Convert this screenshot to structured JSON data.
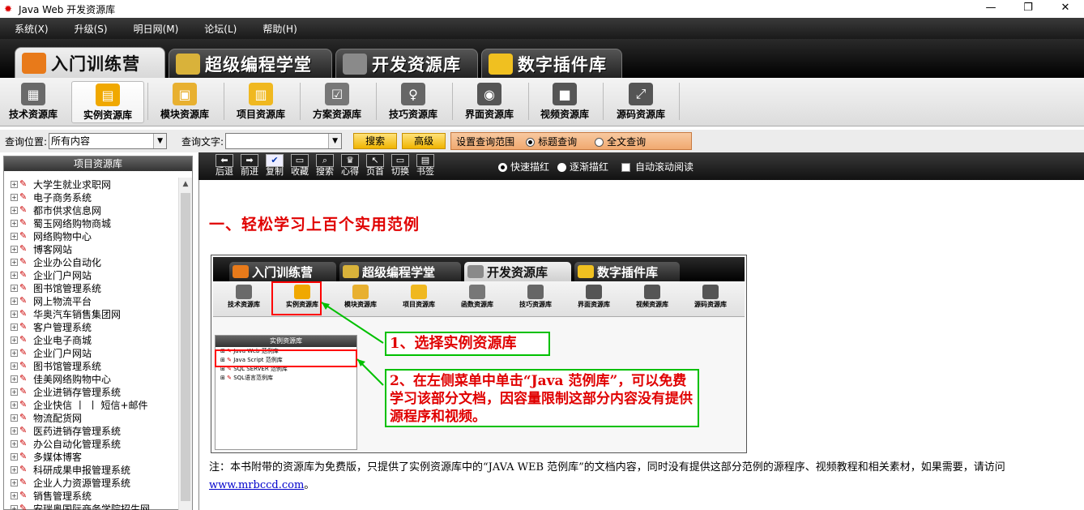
{
  "window": {
    "title": "Java Web  开发资源库",
    "min": "—",
    "max": "❐",
    "close": "✕"
  },
  "menu": [
    "系统(X)",
    "升级(S)",
    "明日网(M)",
    "论坛(L)",
    "帮助(H)"
  ],
  "tabs": [
    {
      "label": "入门训练营",
      "color": "#e87a1a",
      "active": true
    },
    {
      "label": "超级编程学堂",
      "color": "#d9b23a",
      "active": false
    },
    {
      "label": "开发资源库",
      "color": "#8a8a8a",
      "active": false
    },
    {
      "label": "数字插件库",
      "color": "#f0c020",
      "active": false
    }
  ],
  "toolbar": [
    {
      "label": "技术资源库",
      "color": "#6a6a6a",
      "glyph": "▦"
    },
    {
      "label": "实例资源库",
      "color": "#f0a800",
      "glyph": "▤",
      "active": true
    },
    {
      "label": "模块资源库",
      "color": "#e8b030",
      "glyph": "▣"
    },
    {
      "label": "项目资源库",
      "color": "#f0b820",
      "glyph": "▥"
    },
    {
      "label": "方案资源库",
      "color": "#777777",
      "glyph": "☑"
    },
    {
      "label": "技巧资源库",
      "color": "#666666",
      "glyph": "♀"
    },
    {
      "label": "界面资源库",
      "color": "#555555",
      "glyph": "◉"
    },
    {
      "label": "视频资源库",
      "color": "#555555",
      "glyph": "■"
    },
    {
      "label": "源码资源库",
      "color": "#555555",
      "glyph": "⤢"
    }
  ],
  "query": {
    "position_label": "查询位置:",
    "position_value": "所有内容",
    "text_label": "查询文字:",
    "text_value": "",
    "search_button": "搜索",
    "advanced_button": "高级",
    "scope_label": "设置查询范围",
    "title_query": "标题查询",
    "fulltext_query": "全文查询"
  },
  "left_panel": {
    "header": "项目资源库",
    "items": [
      "大学生就业求职网",
      "电子商务系统",
      "都市供求信息网",
      "蜀玉网络购物商城",
      "网络购物中心",
      "博客网站",
      "企业办公自动化",
      "企业门户网站",
      "图书馆管理系统",
      "网上物流平台",
      "华奥汽车销售集团网",
      "客户管理系统",
      "企业电子商城",
      "企业门户网站",
      "图书馆管理系统",
      "佳美网络购物中心",
      "企业进销存管理系统",
      "企业快信 丨 丨 短信+邮件",
      "物流配货网",
      "医药进销存管理系统",
      "办公自动化管理系统",
      "多媒体博客",
      "科研成果申报管理系统",
      "企业人力资源管理系统",
      "销售管理系统",
      "安瑞奥国际商务学院招生网"
    ]
  },
  "reader": {
    "buttons": [
      {
        "label": "后退",
        "glyph": "⬅"
      },
      {
        "label": "前进",
        "glyph": "➡"
      },
      {
        "label": "复制",
        "glyph": "✔",
        "active": true
      },
      {
        "label": "收藏",
        "glyph": "▭"
      },
      {
        "label": "搜索",
        "glyph": "⌕"
      },
      {
        "label": "心得",
        "glyph": "♛"
      },
      {
        "label": "页首",
        "glyph": "↖"
      },
      {
        "label": "切换",
        "glyph": "▭"
      },
      {
        "label": "书签",
        "glyph": "▤"
      }
    ],
    "fast_mark": "快速描红",
    "gradual_mark": "逐渐描红",
    "auto_scroll": "自动滚动阅读"
  },
  "content": {
    "heading": "一、轻松学习上百个实用范例",
    "inner": {
      "tabs": [
        "入门训练营",
        "超级编程学堂",
        "开发资源库",
        "数字插件库"
      ],
      "tab_colors": [
        "#e87a1a",
        "#d9b23a",
        "#8a8a8a",
        "#f0c020"
      ],
      "icons": [
        "技术资源库",
        "实例资源库",
        "模块资源库",
        "项目资源库",
        "函数资源库",
        "技巧资源库",
        "界面资源库",
        "视频资源库",
        "源码资源库"
      ],
      "icon_colors": [
        "#6a6a6a",
        "#f0a800",
        "#e8b030",
        "#f0b820",
        "#777777",
        "#666666",
        "#555555",
        "#555555",
        "#555555"
      ],
      "panel_header": "实例资源库",
      "tree": [
        "Java Web 范例库",
        "Java Script 范例库",
        "SQL SERVER 范例库",
        "SQL语言范例库"
      ]
    },
    "callout1": "1、选择实例资源库",
    "callout2": "2、在左侧菜单中单击“Java  范例库”，可以免费学习该部分文档，因容量限制这部分内容没有提供源程序和视频。",
    "note": "注：本书附带的资源库为免费版，只提供了实例资源库中的“JAVA WEB 范例库”的文档内容，同时没有提供这部分范例的源程序、视频教程和相关素材，如果需要，请访问",
    "link": "www.mrbccd.com",
    "note_end": "。"
  },
  "colors": {
    "red_text": "#e00000",
    "callout_border": "#00c000",
    "highlight_border": "#ff0000",
    "link": "#0000cc"
  }
}
